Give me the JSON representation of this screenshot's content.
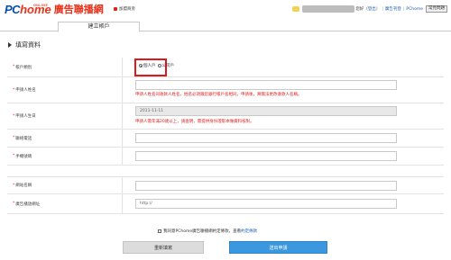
{
  "header": {
    "logo_pc": "PC",
    "logo_home": "home",
    "logo_online": "ONLINE",
    "title": "廣告聯播網",
    "join_label": "加盟商旁",
    "user_suffix": "您好",
    "logout_label": "登出",
    "ad_console_label": "廣告刊登",
    "pchome_label": "PChome",
    "help_label": "常見問題"
  },
  "tabs": [
    {
      "label": "建立帳戶"
    }
  ],
  "section": {
    "title": "填寫資料"
  },
  "form": {
    "account_type": {
      "label": "帳戶類別",
      "options": [
        "個人戶",
        "公司戶"
      ],
      "selected": "個人戶"
    },
    "applicant_name": {
      "label": "申請人姓名",
      "value": "",
      "error": "申請人姓名同收款人姓名，姓名必須跟您銀行帳戶名相同，申請後，將無法更改收款人名稱。"
    },
    "birthday": {
      "label": "申請人生日",
      "value": "2011-11-11",
      "error": "申請人需年滿20歲以上，請查明，需提供身份證影本做資料核對。"
    },
    "phone": {
      "label": "聯絡電話",
      "value": ""
    },
    "mobile": {
      "label": "手機號碼",
      "value": ""
    },
    "site_name": {
      "label": "網站名稱",
      "value": ""
    },
    "ad_url": {
      "label": "廣告播放網址",
      "value": "http://"
    }
  },
  "agreement": {
    "text": "我同意PChome廣告聯播網約定條款，查看",
    "link": "約定條款"
  },
  "buttons": {
    "reset": "重新填寫",
    "submit": "送出申請"
  },
  "colors": {
    "brand_blue": "#0a4fa6",
    "brand_red": "#e8341c",
    "error_red": "#e01c1c",
    "submit_blue": "#3b98de"
  }
}
